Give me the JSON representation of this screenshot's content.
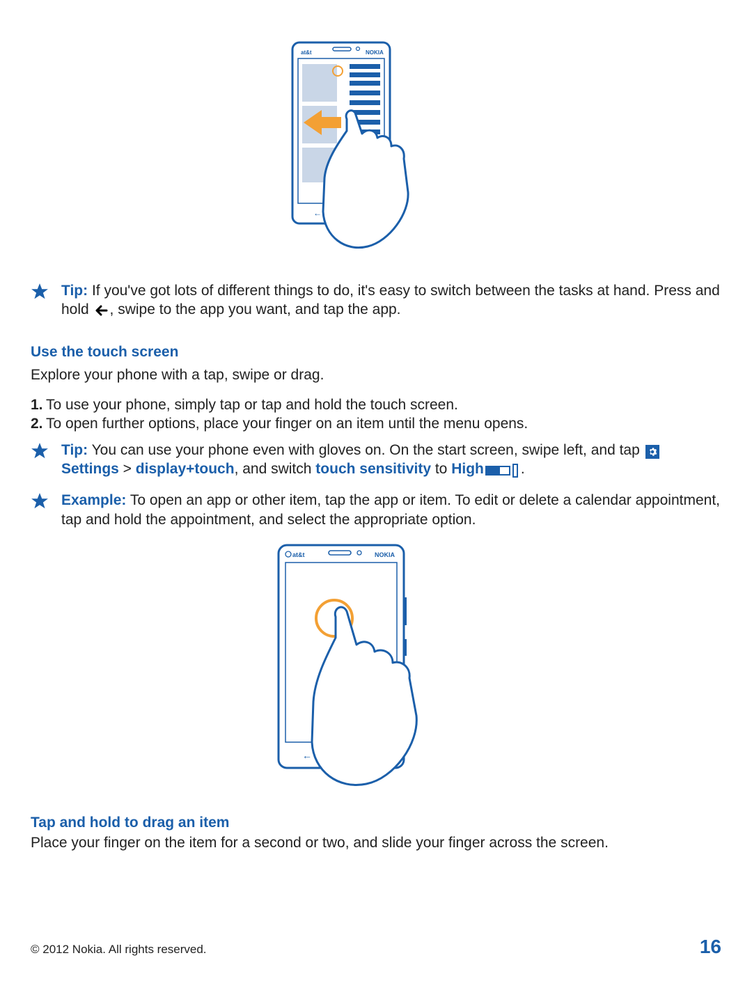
{
  "tip1": {
    "label": "Tip:",
    "text_before": " If you've got lots of different things to do, it's easy to switch between the tasks at hand. Press and hold ",
    "text_after": ", swipe to the app you want, and tap the app."
  },
  "section_touch": {
    "heading": "Use the touch screen",
    "intro": "Explore your phone with a tap, swipe or drag."
  },
  "steps": [
    {
      "num": "1.",
      "text": "To use your phone, simply tap or tap and hold the touch screen."
    },
    {
      "num": "2.",
      "text": "To open further options, place your finger on an item until the menu opens."
    }
  ],
  "tip2": {
    "label": "Tip:",
    "text1": " You can use your phone even with gloves on. On the start screen, swipe left, and tap ",
    "settings": "Settings",
    "gt": " > ",
    "displaytouch": "display+touch",
    "text2": ", and switch ",
    "touch_sensitivity": "touch sensitivity",
    "text3": " to ",
    "high": "High",
    "period": "."
  },
  "example": {
    "label": "Example:",
    "text": " To open an app or other item, tap the app or item. To edit or delete a calendar appointment, tap and hold the appointment, and select the appropriate option."
  },
  "section_drag": {
    "heading": "Tap and hold to drag an item",
    "text": "Place your finger on the item for a second or two, and slide your finger across the screen."
  },
  "footer": {
    "copyright": "© 2012 Nokia. All rights reserved.",
    "page": "16"
  },
  "phone_labels": {
    "carrier": "at&t",
    "brand": "NOKIA"
  }
}
